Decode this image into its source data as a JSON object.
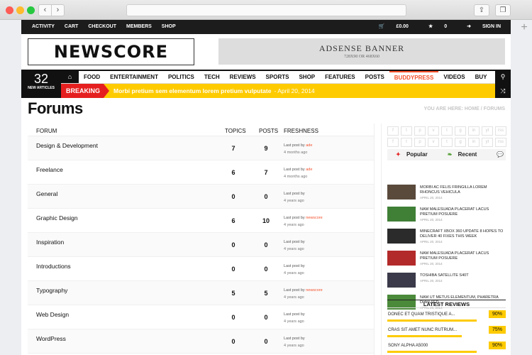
{
  "browser": {
    "back": "‹",
    "forward": "›"
  },
  "topbar": {
    "links": [
      "ACTIVITY",
      "CART",
      "CHECKOUT",
      "MEMBERS",
      "SHOP"
    ],
    "cart": "£0.00",
    "wishlist": "0",
    "signin": "SIGN IN"
  },
  "logo": "NEWSCORE",
  "ad": {
    "title": "ADSENSE BANNER",
    "size": "728X90 OR 468X60"
  },
  "counter": {
    "number": "32",
    "label": "NEW ARTICLES"
  },
  "menu": [
    "FOOD",
    "ENTERTAINMENT",
    "POLITICS",
    "TECH",
    "REVIEWS",
    "SPORTS",
    "SHOP",
    "FEATURES",
    "POSTS",
    "BUDDYPRESS",
    "VIDEOS",
    "BUY"
  ],
  "breaking": {
    "label": "BREAKING",
    "headline": "Morbi pretium sem elementum lorem pretium vulputate",
    "date": "- April 20, 2014"
  },
  "page": {
    "title": "Forums",
    "breadcrumb": "YOU ARE HERE: HOME / FORUMS"
  },
  "forum": {
    "headers": {
      "forum": "FORUM",
      "topics": "TOPICS",
      "posts": "POSTS",
      "freshness": "FRESHNESS"
    },
    "rows": [
      {
        "name": "Design & Development",
        "topics": "7",
        "posts": "9",
        "last": "Last post by",
        "user": "ade",
        "ago": "4 months ago"
      },
      {
        "name": "Freelance",
        "topics": "6",
        "posts": "7",
        "last": "Last post by",
        "user": "ade",
        "ago": "4 months ago"
      },
      {
        "name": "General",
        "topics": "0",
        "posts": "0",
        "last": "Last post by",
        "user": "",
        "ago": "4 years ago"
      },
      {
        "name": "Graphic Design",
        "topics": "6",
        "posts": "10",
        "last": "Last post by",
        "user": "newscore",
        "ago": "4 years ago"
      },
      {
        "name": "Inspiration",
        "topics": "0",
        "posts": "0",
        "last": "Last post by",
        "user": "",
        "ago": "4 years ago"
      },
      {
        "name": "Introductions",
        "topics": "0",
        "posts": "0",
        "last": "Last post by",
        "user": "",
        "ago": "4 years ago"
      },
      {
        "name": "Typography",
        "topics": "5",
        "posts": "5",
        "last": "Last post by",
        "user": "newscore",
        "ago": "4 years ago"
      },
      {
        "name": "Web Design",
        "topics": "0",
        "posts": "0",
        "last": "Last post by",
        "user": "",
        "ago": "4 years ago"
      },
      {
        "name": "WordPress",
        "topics": "0",
        "posts": "0",
        "last": "Last post by",
        "user": "",
        "ago": "4 years ago"
      }
    ]
  },
  "sidebar": {
    "social": [
      "f",
      "t",
      "p",
      "v",
      "t",
      "g",
      "in",
      "yt",
      "rss",
      "f",
      "t",
      "p",
      "v",
      "t",
      "g",
      "in",
      "yt",
      "rss"
    ],
    "tabs": {
      "popular": "Popular",
      "recent": "Recent"
    },
    "posts": [
      {
        "title": "MORBI AC FELIS FRINGILLA LOREM RHONCUS VEHICULA",
        "date": "APRIL 20, 2014",
        "color": "#5a4a3c"
      },
      {
        "title": "NAM MALESUADA PLACERAT LACUS PRETIUM POSUERE",
        "date": "APRIL 20, 2014",
        "color": "#3f7f36"
      },
      {
        "title": "MINECRAFT XBOX 360 UPDATE 8 HOPES TO DELIVER 40 FIXES THIS WEEK",
        "date": "APRIL 20, 2014",
        "color": "#2b2b2b"
      },
      {
        "title": "NAM MALESUADA PLACERAT LACUS PRETIUM POSUERE",
        "date": "APRIL 20, 2014",
        "color": "#b32a2a"
      },
      {
        "title": "TOSHIBA SATELLITE S40T",
        "date": "APRIL 20, 2014",
        "color": "#3a3a4a"
      },
      {
        "title": "NAM UT METUS ELEMENTUM, PHARETRA DIAM SED",
        "date": "APRIL 20, 2014",
        "color": "#4b8a3a"
      }
    ],
    "reviews_title": "LATEST REVIEWS",
    "reviews": [
      {
        "name": "DONEC ET QUAM TRISTIQUE A...",
        "pct": "90%",
        "value": 0.9
      },
      {
        "name": "CRAS SIT AMET NUNC RUTRUM...",
        "pct": "75%",
        "value": 0.75
      },
      {
        "name": "SONY ALPHA A5000",
        "pct": "90%",
        "value": 0.9
      }
    ]
  }
}
